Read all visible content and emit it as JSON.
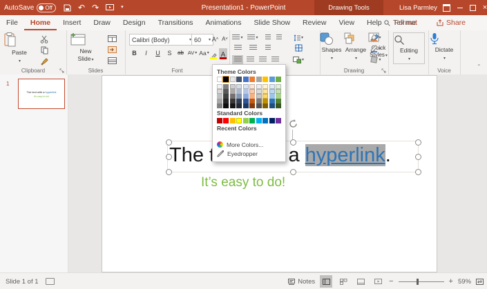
{
  "titlebar": {
    "autosave": "AutoSave",
    "autosave_state": "Off",
    "title": "Presentation1 - PowerPoint",
    "context": "Drawing Tools",
    "user": "Lisa Parmley"
  },
  "tabs": [
    {
      "label": "File"
    },
    {
      "label": "Home",
      "active": true
    },
    {
      "label": "Insert"
    },
    {
      "label": "Draw"
    },
    {
      "label": "Design"
    },
    {
      "label": "Transitions"
    },
    {
      "label": "Animations"
    },
    {
      "label": "Slide Show"
    },
    {
      "label": "Review"
    },
    {
      "label": "View"
    },
    {
      "label": "Help"
    },
    {
      "label": "Format",
      "contextual": true
    }
  ],
  "tab_extras": {
    "tellme": "Tell me",
    "share": "Share"
  },
  "ribbon": {
    "clipboard": {
      "label": "Clipboard",
      "paste": "Paste"
    },
    "slides": {
      "label": "Slides",
      "new_slide_1": "New",
      "new_slide_2": "Slide"
    },
    "font": {
      "label": "Font",
      "name": "Calibri (Body)",
      "size": "60",
      "bold": "B",
      "italic": "I",
      "underline": "U",
      "strike": "S",
      "strike2": "ab",
      "spacing": "AV",
      "case": "Aa",
      "color_letter": "A",
      "inc": "A",
      "dec": "A",
      "clear": "A"
    },
    "drawing": {
      "label": "Drawing",
      "shapes": "Shapes",
      "arrange": "Arrange",
      "quick1": "Quick",
      "quick2": "Styles"
    },
    "editing": {
      "label": "Editing"
    },
    "voice": {
      "label": "Voice",
      "dictate": "Dictate"
    }
  },
  "color_picker": {
    "theme_header": "Theme Colors",
    "standard_header": "Standard Colors",
    "recent_header": "Recent Colors",
    "more_colors": "More Colors...",
    "eyedropper": "Eyedropper",
    "selected_index": 1,
    "theme_colors": [
      {
        "name": "White",
        "base": "#FFFFFF",
        "tints": [
          "#F2F2F2",
          "#D9D9D9",
          "#BFBFBF",
          "#A6A6A6",
          "#808080"
        ]
      },
      {
        "name": "Black",
        "base": "#000000",
        "tints": [
          "#7F7F7F",
          "#595959",
          "#404040",
          "#262626",
          "#0D0D0D"
        ]
      },
      {
        "name": "Light Gray",
        "base": "#E7E6E6",
        "tints": [
          "#D0CECE",
          "#AEAAAA",
          "#757171",
          "#3A3838",
          "#161616"
        ]
      },
      {
        "name": "Blue-Gray",
        "base": "#44546A",
        "tints": [
          "#D6DCE5",
          "#ACB9CA",
          "#8496B0",
          "#333F50",
          "#222A35"
        ]
      },
      {
        "name": "Blue",
        "base": "#4472C4",
        "tints": [
          "#D9E2F3",
          "#B4C7E7",
          "#8EAADB",
          "#2F5597",
          "#1F3864"
        ]
      },
      {
        "name": "Orange",
        "base": "#ED7D31",
        "tints": [
          "#FBE5D6",
          "#F7CBAC",
          "#F4B183",
          "#C55A11",
          "#843C0C"
        ]
      },
      {
        "name": "Gray",
        "base": "#A5A5A5",
        "tints": [
          "#EDEDED",
          "#DBDBDB",
          "#C9C9C9",
          "#7B7B7B",
          "#525252"
        ]
      },
      {
        "name": "Gold",
        "base": "#FFC000",
        "tints": [
          "#FFF2CC",
          "#FFE599",
          "#FFD966",
          "#BF9000",
          "#7F6000"
        ]
      },
      {
        "name": "Light Blue",
        "base": "#5B9BD5",
        "tints": [
          "#DEEBF7",
          "#BDD7EE",
          "#9DC3E6",
          "#2E75B6",
          "#1F4E79"
        ]
      },
      {
        "name": "Green",
        "base": "#70AD47",
        "tints": [
          "#E2F0D9",
          "#C6E0B4",
          "#A9D18E",
          "#548235",
          "#375623"
        ]
      }
    ],
    "standard_colors": [
      "#C00000",
      "#FF0000",
      "#FFC000",
      "#FFFF00",
      "#92D050",
      "#00B050",
      "#00B0F0",
      "#0070C0",
      "#002060",
      "#7030A0"
    ]
  },
  "slide": {
    "text_before": "The text with a ",
    "hyperlink": "hyperlink",
    "text_after": ".",
    "subtitle": "It’s easy to do!",
    "hyperlink_color": "#2E74B5",
    "highlight_color": "#A9A9A9",
    "subtitle_color": "#7DBB42"
  },
  "thumbnail": {
    "number": "1"
  },
  "statusbar": {
    "slide_counter": "Slide 1 of 1",
    "notes": "Notes",
    "zoom_level": "59%"
  },
  "icons": {
    "chevron": "▾",
    "undo": "↶",
    "redo": "↷",
    "close": "×"
  },
  "colors": {
    "titlebar": "#B7472A",
    "context_bg": "#9E3B20",
    "accent": "#B7472A"
  }
}
